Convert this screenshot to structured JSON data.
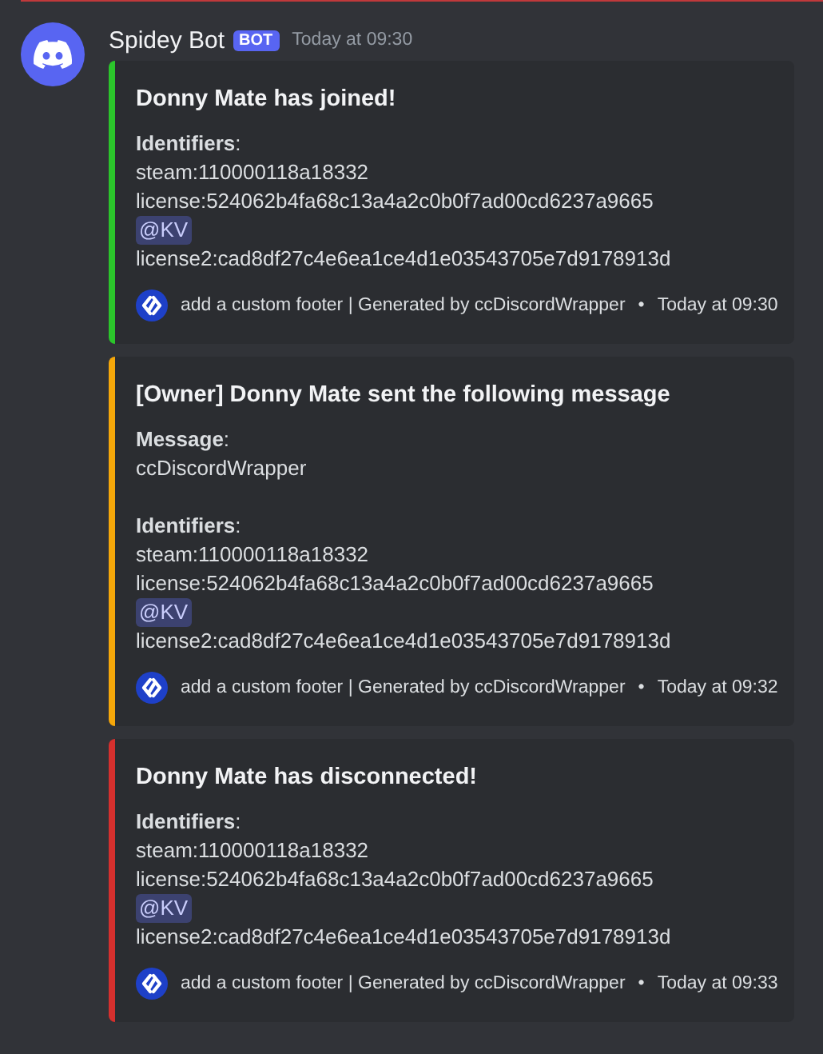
{
  "message": {
    "author": "Spidey Bot",
    "badge": "BOT",
    "timestamp": "Today at 09:30",
    "embeds": [
      {
        "color": "#2bc52b",
        "title": "Donny Mate has joined!",
        "sections": [
          {
            "label": "**Identifiers**:",
            "lines": [
              {
                "kind": "text",
                "text": "steam:110000118a18332"
              },
              {
                "kind": "text",
                "text": "license:524062b4fa68c13a4a2c0b0f7ad00cd6237a9665"
              },
              {
                "kind": "mention",
                "text": "@KV"
              },
              {
                "kind": "text",
                "text": "license2:cad8df27c4e6ea1ce4d1e03543705e7d9178913d"
              }
            ]
          }
        ],
        "footer": {
          "text": "add a custom footer | Generated by ccDiscordWrapper",
          "separator": "•",
          "time": "Today at 09:30"
        }
      },
      {
        "color": "#f5a70a",
        "title": "[Owner] Donny Mate sent the following message",
        "sections": [
          {
            "label": "**Message**:",
            "lines": [
              {
                "kind": "text",
                "text": "ccDiscordWrapper"
              }
            ]
          },
          {
            "label": "**Identifiers**:",
            "lines": [
              {
                "kind": "text",
                "text": "steam:110000118a18332"
              },
              {
                "kind": "text",
                "text": "license:524062b4fa68c13a4a2c0b0f7ad00cd6237a9665"
              },
              {
                "kind": "mention",
                "text": "@KV"
              },
              {
                "kind": "text",
                "text": "license2:cad8df27c4e6ea1ce4d1e03543705e7d9178913d"
              }
            ]
          }
        ],
        "footer": {
          "text": "add a custom footer | Generated by ccDiscordWrapper",
          "separator": "•",
          "time": "Today at 09:32"
        }
      },
      {
        "color": "#d5302e",
        "title": "Donny Mate has disconnected!",
        "sections": [
          {
            "label": "**Identifiers**:",
            "lines": [
              {
                "kind": "text",
                "text": "steam:110000118a18332"
              },
              {
                "kind": "text",
                "text": "license:524062b4fa68c13a4a2c0b0f7ad00cd6237a9665"
              },
              {
                "kind": "mention",
                "text": "@KV"
              },
              {
                "kind": "text",
                "text": "license2:cad8df27c4e6ea1ce4d1e03543705e7d9178913d"
              }
            ]
          }
        ],
        "footer": {
          "text": "add a custom footer | Generated by ccDiscordWrapper",
          "separator": "•",
          "time": "Today at 09:33"
        }
      }
    ]
  }
}
